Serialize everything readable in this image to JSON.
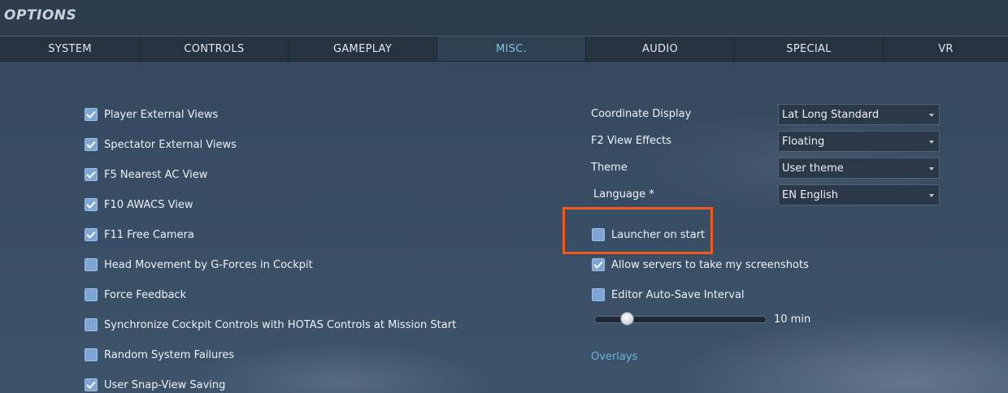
{
  "window": {
    "title": "OPTIONS"
  },
  "tabs": [
    {
      "label": "SYSTEM",
      "active": false
    },
    {
      "label": "CONTROLS",
      "active": false
    },
    {
      "label": "GAMEPLAY",
      "active": false
    },
    {
      "label": "MISC.",
      "active": true
    },
    {
      "label": "AUDIO",
      "active": false
    },
    {
      "label": "SPECIAL",
      "active": false
    },
    {
      "label": "VR",
      "active": false
    }
  ],
  "left_checkboxes": [
    {
      "label": "Player External Views",
      "checked": true
    },
    {
      "label": "Spectator External Views",
      "checked": true
    },
    {
      "label": "F5 Nearest AC View",
      "checked": true
    },
    {
      "label": "F10 AWACS View",
      "checked": true
    },
    {
      "label": "F11 Free Camera",
      "checked": true
    },
    {
      "label": "Head Movement by G-Forces in Cockpit",
      "checked": false
    },
    {
      "label": "Force Feedback",
      "checked": false
    },
    {
      "label": "Synchronize Cockpit Controls with HOTAS Controls at Mission Start",
      "checked": false
    },
    {
      "label": "Random System Failures",
      "checked": false
    },
    {
      "label": "User Snap-View Saving",
      "checked": true
    }
  ],
  "dropdowns": [
    {
      "label": "Coordinate Display",
      "value": "Lat Long Standard"
    },
    {
      "label": "F2 View Effects",
      "value": "Floating"
    },
    {
      "label": "Theme",
      "value": "User theme"
    },
    {
      "label": "Language *",
      "value": "EN English"
    }
  ],
  "right_checkboxes": [
    {
      "label": "Launcher on start",
      "checked": false
    },
    {
      "label": "Allow servers to take my screenshots",
      "checked": true
    },
    {
      "label": "Editor Auto-Save Interval",
      "checked": false
    }
  ],
  "autosave_slider": {
    "value_label": "10 min",
    "fraction": 0.16
  },
  "overlays_heading": "Overlays",
  "colors": {
    "accent": "#7ec3e8",
    "checkbox": "#7ea6d4",
    "highlight": "#f05a1e",
    "link": "#6ab4e0"
  }
}
